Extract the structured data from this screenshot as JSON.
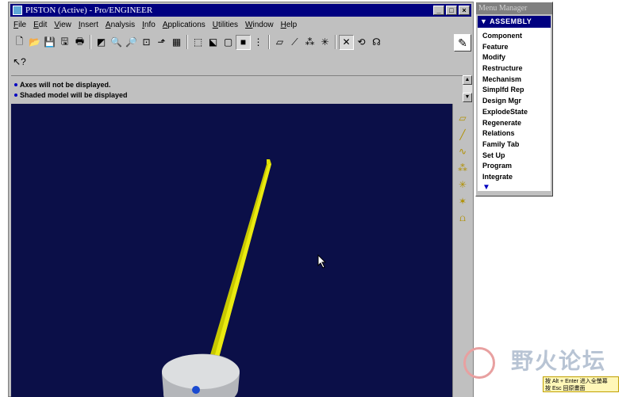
{
  "window": {
    "title": "PISTON (Active) - Pro/ENGINEER",
    "controls": [
      "_",
      "□",
      "×"
    ]
  },
  "menubar": [
    "File",
    "Edit",
    "View",
    "Insert",
    "Analysis",
    "Info",
    "Applications",
    "Utilities",
    "Window",
    "Help"
  ],
  "toolbar1": [
    {
      "icon": "new-icon",
      "glyph": "🗋"
    },
    {
      "icon": "open-icon",
      "glyph": "📂"
    },
    {
      "icon": "save-icon",
      "glyph": "💾"
    },
    {
      "icon": "save-copy-icon",
      "glyph": "🖫"
    },
    {
      "icon": "print-icon",
      "glyph": "🖶"
    },
    {
      "icon": "sep"
    },
    {
      "icon": "repaint-icon",
      "glyph": "◩"
    },
    {
      "icon": "zoom-in-icon",
      "glyph": "🔍"
    },
    {
      "icon": "zoom-out-icon",
      "glyph": "🔎"
    },
    {
      "icon": "refit-icon",
      "glyph": "⊡"
    },
    {
      "icon": "orient-icon",
      "glyph": "⬏"
    },
    {
      "icon": "saved-views-icon",
      "glyph": "▦"
    },
    {
      "icon": "sep"
    },
    {
      "icon": "wireframe-icon",
      "glyph": "⬚"
    },
    {
      "icon": "hidden-line-icon",
      "glyph": "⬕"
    },
    {
      "icon": "no-hidden-icon",
      "glyph": "▢"
    },
    {
      "icon": "shading-icon",
      "glyph": "■"
    },
    {
      "icon": "model-tree-icon",
      "glyph": "⋮"
    },
    {
      "icon": "sep"
    },
    {
      "icon": "datum-planes-icon",
      "glyph": "▱"
    },
    {
      "icon": "datum-axes-icon",
      "glyph": "⟋"
    },
    {
      "icon": "datum-points-icon",
      "glyph": "⁂"
    },
    {
      "icon": "coord-sys-icon",
      "glyph": "✳"
    },
    {
      "icon": "sep"
    },
    {
      "icon": "spin-center-icon",
      "glyph": "✕"
    },
    {
      "icon": "spin-icon",
      "glyph": "⟲"
    },
    {
      "icon": "sensor-icon",
      "glyph": "☊"
    }
  ],
  "toolbar2": [
    {
      "icon": "context-help-icon",
      "glyph": "↖?"
    }
  ],
  "sketch_button_glyph": "✎",
  "messages": [
    "Axes will not be displayed.",
    "Shaded model will be displayed"
  ],
  "right_tools": [
    {
      "icon": "datum-plane-tool-icon",
      "glyph": "▱"
    },
    {
      "icon": "datum-axis-tool-icon",
      "glyph": "╱"
    },
    {
      "icon": "datum-curve-tool-icon",
      "glyph": "∿"
    },
    {
      "icon": "datum-point-tool-icon",
      "glyph": "⁂"
    },
    {
      "icon": "coord-sys-tool-icon",
      "glyph": "✳"
    },
    {
      "icon": "analysis-tool-icon",
      "glyph": "✶"
    },
    {
      "icon": "eval-tool-icon",
      "glyph": "⩍"
    }
  ],
  "menu_manager": {
    "title": "Menu Manager",
    "header": "ASSEMBLY",
    "items": [
      "Component",
      "Feature",
      "Modify",
      "Restructure",
      "Mechanism",
      "Simplfd Rep",
      "Design Mgr",
      "ExplodeState",
      "Regenerate",
      "Relations",
      "Family Tab",
      "Set Up",
      "Program",
      "Integrate"
    ],
    "more_glyph": "▼"
  },
  "watermark": {
    "text": "野火论坛",
    "hint_line1": "按 Alt + Enter 进入全螢幕",
    "hint_line2": "按 Esc 回原畫面"
  },
  "colors": {
    "viewport_bg": "#0b0f48",
    "rod": "#d6d600",
    "disc": "#d0d2d4",
    "title_bar": "#000080"
  }
}
